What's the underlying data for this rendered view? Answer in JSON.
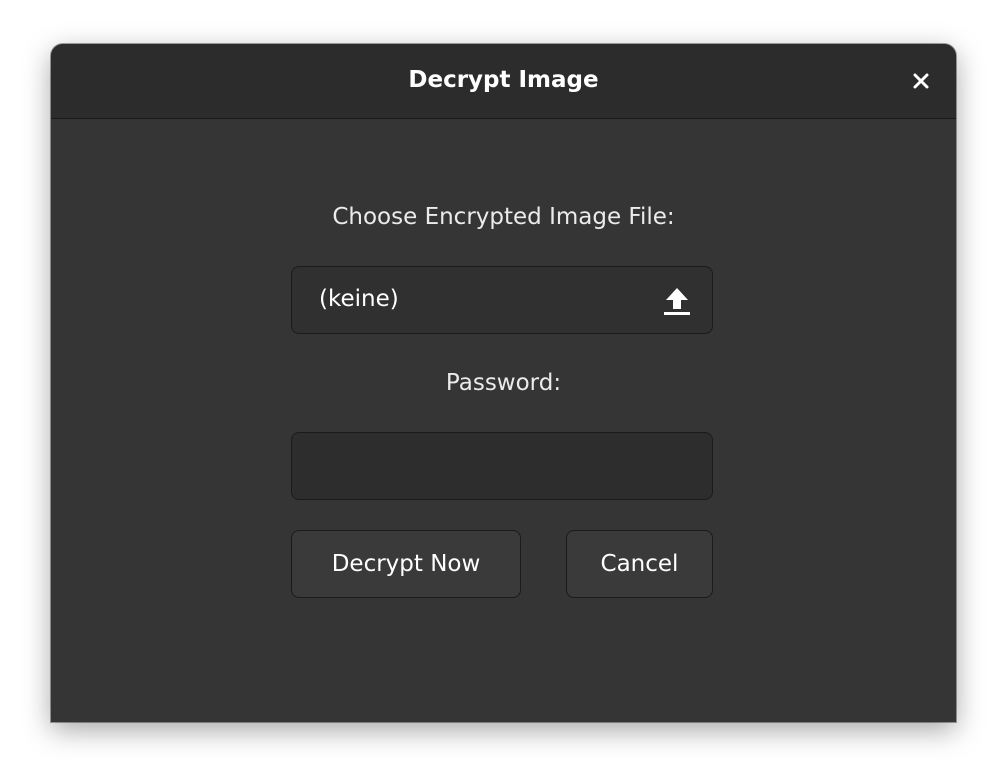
{
  "dialog": {
    "title": "Decrypt Image",
    "close_icon": "close-icon"
  },
  "file_section": {
    "label": "Choose Encrypted Image File:",
    "value": "(keine)",
    "icon": "upload-icon"
  },
  "password_section": {
    "label": "Password:",
    "value": "",
    "placeholder": ""
  },
  "buttons": {
    "decrypt_label": "Decrypt Now",
    "cancel_label": "Cancel"
  },
  "colors": {
    "window_bg": "#353535",
    "titlebar_bg": "#2c2c2c",
    "text": "#ffffff"
  }
}
